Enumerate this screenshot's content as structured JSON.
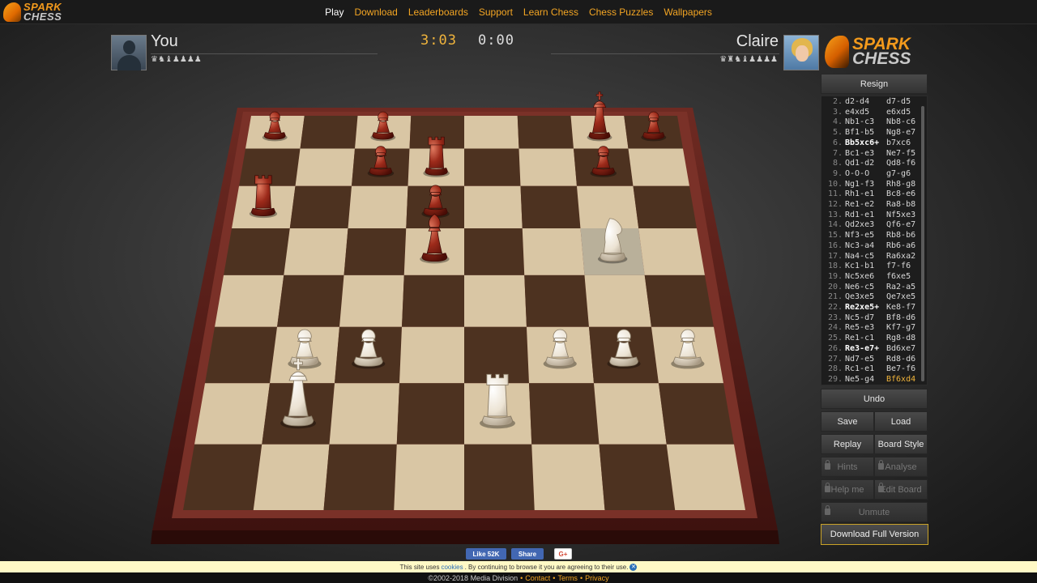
{
  "nav": {
    "logo_line1": "SPARK",
    "logo_line2": "CHESS",
    "items": [
      "Play",
      "Download",
      "Leaderboards",
      "Support",
      "Learn Chess",
      "Chess Puzzles",
      "Wallpapers"
    ],
    "active": "Play",
    "link_color": "#f3a523"
  },
  "player_you": {
    "name": "You",
    "captured": "♛♞♝♟♟♟♟",
    "clock": "3:03"
  },
  "player_opponent": {
    "name": "Claire",
    "captured": "♛♜♞♝♟♟♟♟",
    "clock": "0:00"
  },
  "logo_big": {
    "line1": "SPARK",
    "line2": "CHESS"
  },
  "panel": {
    "resign": "Resign",
    "undo": "Undo",
    "save": "Save",
    "load": "Load",
    "replay": "Replay",
    "board_style": "Board Style",
    "hints": "Hints",
    "analyse": "Analyse",
    "help_me": "Help me",
    "edit_board": "Edit Board",
    "unmute": "Unmute",
    "download_full": "Download Full Version",
    "accent": "#c9a227"
  },
  "moves": [
    {
      "n": "2.",
      "w": "d2-d4",
      "b": "d7-d5"
    },
    {
      "n": "3.",
      "w": "e4xd5",
      "b": "e6xd5"
    },
    {
      "n": "4.",
      "w": "Nb1-c3",
      "b": "Nb8-c6"
    },
    {
      "n": "5.",
      "w": "Bf1-b5",
      "b": "Ng8-e7"
    },
    {
      "n": "6.",
      "w": "Bb5xc6+",
      "b": "b7xc6",
      "w_bold": true
    },
    {
      "n": "7.",
      "w": "Bc1-e3",
      "b": "Ne7-f5"
    },
    {
      "n": "8.",
      "w": "Qd1-d2",
      "b": "Qd8-f6"
    },
    {
      "n": "9.",
      "w": "O-O-O",
      "b": "g7-g6"
    },
    {
      "n": "10.",
      "w": "Ng1-f3",
      "b": "Rh8-g8"
    },
    {
      "n": "11.",
      "w": "Rh1-e1",
      "b": "Bc8-e6"
    },
    {
      "n": "12.",
      "w": "Re1-e2",
      "b": "Ra8-b8"
    },
    {
      "n": "13.",
      "w": "Rd1-e1",
      "b": "Nf5xe3"
    },
    {
      "n": "14.",
      "w": "Qd2xe3",
      "b": "Qf6-e7"
    },
    {
      "n": "15.",
      "w": "Nf3-e5",
      "b": "Rb8-b6"
    },
    {
      "n": "16.",
      "w": "Nc3-a4",
      "b": "Rb6-a6"
    },
    {
      "n": "17.",
      "w": "Na4-c5",
      "b": "Ra6xa2"
    },
    {
      "n": "18.",
      "w": "Kc1-b1",
      "b": "f7-f6"
    },
    {
      "n": "19.",
      "w": "Nc5xe6",
      "b": "f6xe5"
    },
    {
      "n": "20.",
      "w": "Ne6-c5",
      "b": "Ra2-a5"
    },
    {
      "n": "21.",
      "w": "Qe3xe5",
      "b": "Qe7xe5"
    },
    {
      "n": "22.",
      "w": "Re2xe5+",
      "b": "Ke8-f7",
      "w_bold": true
    },
    {
      "n": "23.",
      "w": "Nc5-d7",
      "b": "Bf8-d6"
    },
    {
      "n": "24.",
      "w": "Re5-e3",
      "b": "Kf7-g7"
    },
    {
      "n": "25.",
      "w": "Re1-c1",
      "b": "Rg8-d8"
    },
    {
      "n": "26.",
      "w": "Re3-e7+",
      "b": "Bd6xe7",
      "w_bold": true
    },
    {
      "n": "27.",
      "w": "Nd7-e5",
      "b": "Rd8-d6"
    },
    {
      "n": "28.",
      "w": "Rc1-e1",
      "b": "Be7-f6"
    },
    {
      "n": "29.",
      "w": "Ne5-g4",
      "b": "Bf6xd4",
      "b_hl": true
    }
  ],
  "board": {
    "light_square": "#d9c6a4",
    "dark_square": "#4d3220",
    "frame": "#5c1f1a",
    "pieces": [
      {
        "type": "pawn",
        "color": "black",
        "file": 0,
        "rank": 7
      },
      {
        "type": "pawn",
        "color": "black",
        "file": 2,
        "rank": 7
      },
      {
        "type": "king",
        "color": "black",
        "file": 6,
        "rank": 7
      },
      {
        "type": "pawn",
        "color": "black",
        "file": 7,
        "rank": 7
      },
      {
        "type": "pawn",
        "color": "black",
        "file": 2,
        "rank": 6
      },
      {
        "type": "rook",
        "color": "black",
        "file": 3,
        "rank": 6
      },
      {
        "type": "pawn",
        "color": "black",
        "file": 6,
        "rank": 6
      },
      {
        "type": "rook",
        "color": "black",
        "file": 0,
        "rank": 5
      },
      {
        "type": "pawn",
        "color": "black",
        "file": 3,
        "rank": 5
      },
      {
        "type": "bishop",
        "color": "black",
        "file": 3,
        "rank": 4
      },
      {
        "type": "knight",
        "color": "white",
        "file": 6,
        "rank": 4
      },
      {
        "type": "pawn",
        "color": "white",
        "file": 1,
        "rank": 2
      },
      {
        "type": "pawn",
        "color": "white",
        "file": 2,
        "rank": 2
      },
      {
        "type": "pawn",
        "color": "white",
        "file": 5,
        "rank": 2
      },
      {
        "type": "pawn",
        "color": "white",
        "file": 6,
        "rank": 2
      },
      {
        "type": "pawn",
        "color": "white",
        "file": 7,
        "rank": 2
      },
      {
        "type": "king",
        "color": "white",
        "file": 1,
        "rank": 1
      },
      {
        "type": "rook",
        "color": "white",
        "file": 4,
        "rank": 1
      }
    ],
    "highlight_square": {
      "file": 6,
      "rank": 4
    }
  },
  "footer": {
    "fb_like": "Like 52K",
    "fb_share": "Share",
    "gplus": "G+",
    "cookie_text_before": "This site uses",
    "cookie_link": "cookies",
    "cookie_text_after": ". By continuing to browse it you are agreeing to their use.",
    "cookie_close": "✕",
    "copyright": "©2002-2018 Media Division",
    "contact": "Contact",
    "terms": "Terms",
    "privacy": "Privacy"
  }
}
